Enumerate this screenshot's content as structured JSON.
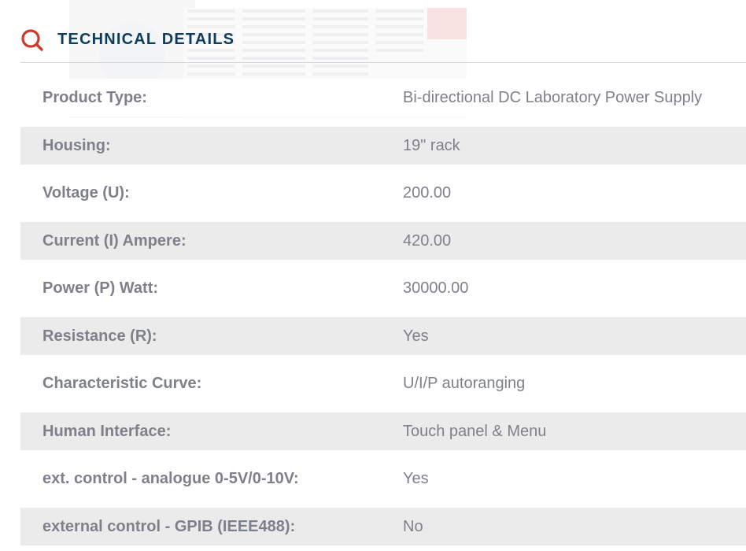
{
  "section": {
    "title": "TECHNICAL DETAILS",
    "icon": "search-icon",
    "accent_color": "#d0382b",
    "title_color": "#0e3d5c"
  },
  "specs": [
    {
      "label": "Product Type:",
      "value": "Bi-directional DC Laboratory Power Supply"
    },
    {
      "label": "Housing:",
      "value": "19\" rack"
    },
    {
      "label": "Voltage (U):",
      "value": "200.00"
    },
    {
      "label": "Current (I) Ampere:",
      "value": "420.00"
    },
    {
      "label": "Power (P) Watt:",
      "value": "30000.00"
    },
    {
      "label": "Resistance (R):",
      "value": "Yes"
    },
    {
      "label": "Characteristic Curve:",
      "value": "U/I/P autoranging"
    },
    {
      "label": "Human Interface:",
      "value": "Touch panel & Menu"
    },
    {
      "label": "ext. control - analogue 0-5V/0-10V:",
      "value": "Yes"
    },
    {
      "label": "external control - GPIB (IEEE488):",
      "value": "No"
    }
  ]
}
